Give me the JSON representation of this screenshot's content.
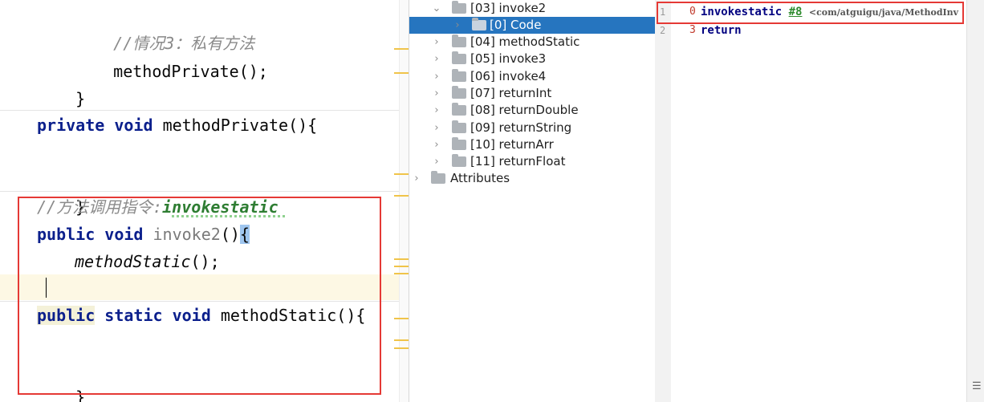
{
  "editor": {
    "lines": {
      "comment_case3": "//情况3：私有方法",
      "call_method_private": "methodPrivate();",
      "close1": "}",
      "private_kw": "private",
      "void_kw1": "void",
      "method_private_decl": "methodPrivate(){",
      "close2": "}",
      "comment_invokestatic_prefix": "//方法调用指令:",
      "comment_invokestatic_word": "invokestatic",
      "public_kw1": "public",
      "void_kw2": "void",
      "invoke2_name": "invoke2",
      "invoke2_paren": "()",
      "invoke2_brace": "{",
      "call_method_static": "methodStatic",
      "call_method_static_end": "();",
      "close3": "}",
      "public_kw2": "public",
      "static_kw": "static",
      "void_kw3": "void",
      "method_static_decl": "methodStatic(){",
      "close4": "}"
    }
  },
  "tree": {
    "items": [
      {
        "label": "[03] invoke2",
        "expanded": true
      },
      {
        "label": "[0] Code",
        "selected": true
      },
      {
        "label": "[04] methodStatic"
      },
      {
        "label": "[05] invoke3"
      },
      {
        "label": "[06] invoke4"
      },
      {
        "label": "[07] returnInt"
      },
      {
        "label": "[08] returnDouble"
      },
      {
        "label": "[09] returnString"
      },
      {
        "label": "[10] returnArr"
      },
      {
        "label": "[11] returnFloat"
      },
      {
        "label": "Attributes"
      }
    ]
  },
  "bytecode": {
    "rows": [
      {
        "line": "1",
        "offset": "0",
        "opcode": "invokestatic",
        "ref": "#8",
        "comment": "<com/atguigu/java/MethodInv"
      },
      {
        "line": "2",
        "offset": "3",
        "opcode": "return",
        "ref": "",
        "comment": ""
      }
    ]
  },
  "colors": {
    "highlight_box": "#e53935",
    "selection": "#2675bf",
    "keyword": "#0b1f8c",
    "comment": "#8a8a8a"
  }
}
